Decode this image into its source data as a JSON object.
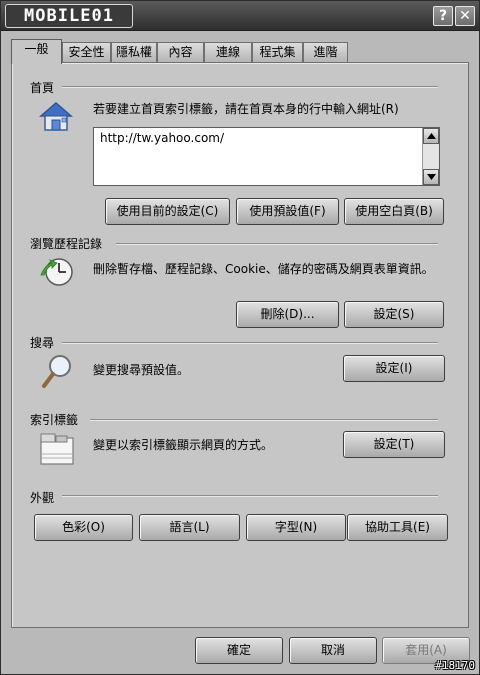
{
  "window": {
    "title_logo": "MOBILE01",
    "help_label": "?",
    "close_label": "✕"
  },
  "tabs": [
    {
      "label": "一般",
      "active": true
    },
    {
      "label": "安全性"
    },
    {
      "label": "隱私權"
    },
    {
      "label": "內容"
    },
    {
      "label": "連線"
    },
    {
      "label": "程式集"
    },
    {
      "label": "進階"
    }
  ],
  "home": {
    "title": "首頁",
    "description": "若要建立首頁索引標籤，請在首頁本身的行中輸入網址(R)",
    "url": "http://tw.yahoo.com/",
    "use_current": "使用目前的設定(C)",
    "use_default": "使用預設值(F)",
    "use_blank": "使用空白頁(B)",
    "icon": "home-icon"
  },
  "history": {
    "title": "瀏覽歷程記錄",
    "description": "刪除暫存檔、歷程記錄、Cookie、儲存的密碼及網頁表單資訊。",
    "delete_label": "刪除(D)...",
    "settings_label": "設定(S)",
    "icon": "history-clock-icon"
  },
  "search": {
    "title": "搜尋",
    "description": "變更搜尋預設值。",
    "settings_label": "設定(I)",
    "icon": "magnifier-icon"
  },
  "tabs_section": {
    "title": "索引標籤",
    "description": "變更以索引標籤顯示網頁的方式。",
    "settings_label": "設定(T)",
    "icon": "tabbed-window-icon"
  },
  "appearance": {
    "title": "外觀",
    "colors_label": "色彩(O)",
    "languages_label": "語言(L)",
    "fonts_label": "字型(N)",
    "accessibility_label": "協助工具(E)"
  },
  "footer": {
    "ok_label": "確定",
    "cancel_label": "取消",
    "apply_label": "套用(A)"
  },
  "watermark": "#18170"
}
